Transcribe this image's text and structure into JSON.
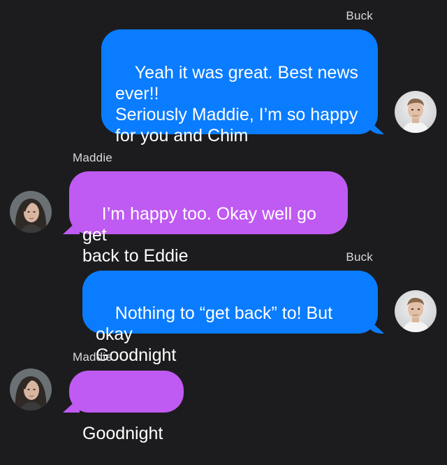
{
  "messages": [
    {
      "sender": "Buck",
      "direction": "outgoing",
      "text": "Yeah it was great. Best news\never!!\nSeriously Maddie, I’m so happy\nfor you and Chim"
    },
    {
      "sender": "Maddie",
      "direction": "incoming",
      "text": "I’m happy too. Okay well go get\nback to Eddie"
    },
    {
      "sender": "Buck",
      "direction": "outgoing",
      "text": "Nothing to “get back” to! But okay\nGoodnight"
    },
    {
      "sender": "Maddie",
      "direction": "incoming",
      "text": "Goodnight"
    }
  ],
  "colors": {
    "background": "#1c1c1e",
    "outgoing_bubble": "#0a7cff",
    "incoming_bubble": "#bf5af2",
    "sender_name": "#d9d9de"
  },
  "avatars": {
    "buck": "avatar-photo-buck",
    "maddie": "avatar-photo-maddie"
  }
}
